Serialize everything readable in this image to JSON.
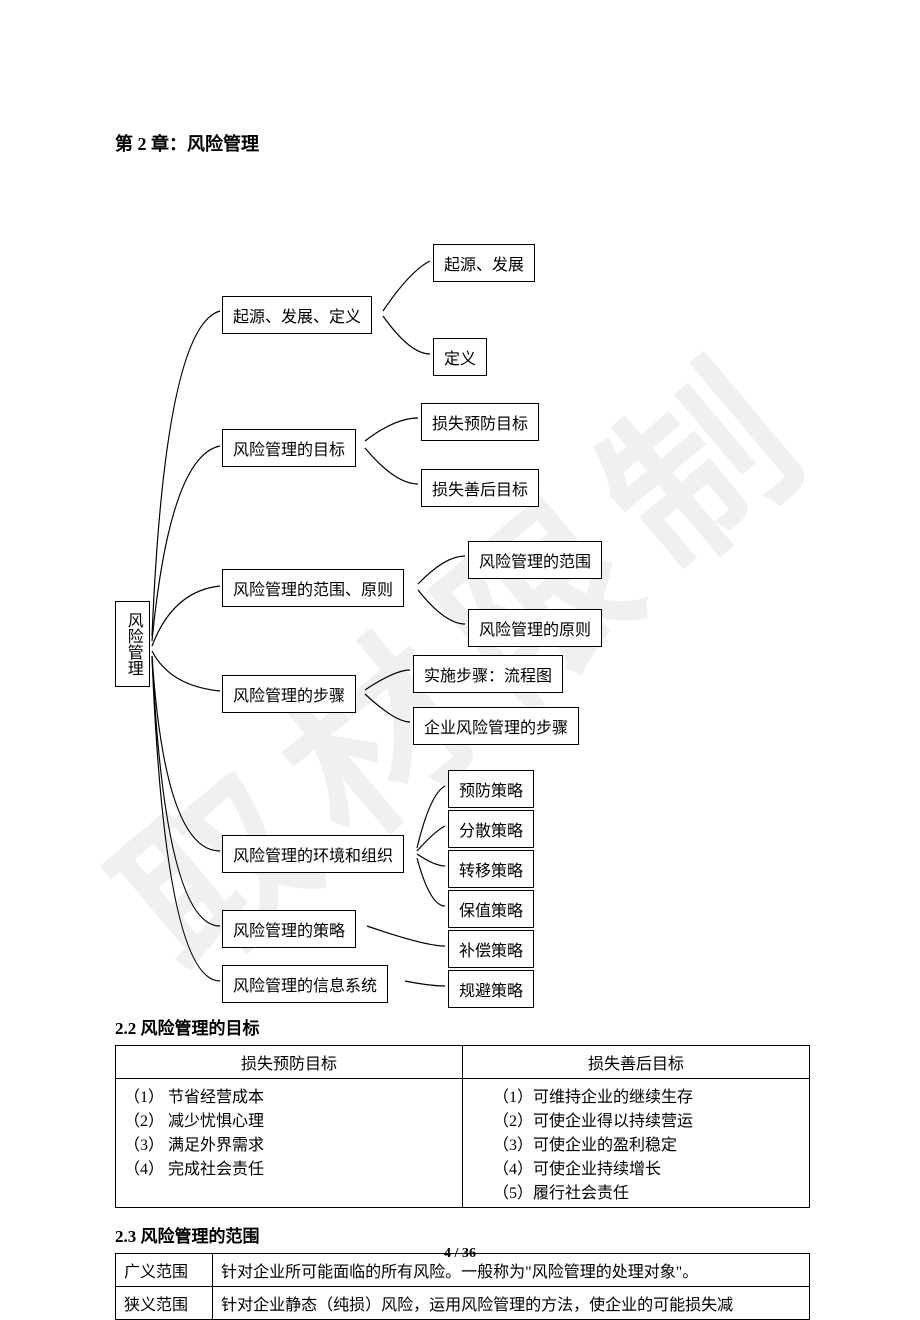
{
  "chapter_title": "第 2 章：风险管理",
  "diagram": {
    "root": "风险管理",
    "b1": {
      "label": "起源、发展、定义",
      "c1": "起源、发展",
      "c2": "定义"
    },
    "b2": {
      "label": "风险管理的目标",
      "c1": "损失预防目标",
      "c2": "损失善后目标"
    },
    "b3": {
      "label": "风险管理的范围、原则",
      "c1": "风险管理的范围",
      "c2": "风险管理的原则"
    },
    "b4": {
      "label": "风险管理的步骤",
      "c1": "实施步骤：流程图",
      "c2": "企业风险管理的步骤"
    },
    "b5": {
      "label": "风险管理的环境和组织"
    },
    "b6": {
      "label": "风险管理的策略",
      "s1": "预防策略",
      "s2": "分散策略",
      "s3": "转移策略",
      "s4": "保值策略",
      "s5": "补偿策略",
      "s6": "规避策略"
    },
    "b7": {
      "label": "风险管理的信息系统"
    }
  },
  "section22": {
    "title": "2.2 风险管理的目标",
    "header": [
      "损失预防目标",
      "损失善后目标"
    ],
    "left": [
      "（1） 节省经营成本",
      "（2） 减少忧惧心理",
      "（3） 满足外界需求",
      "（4） 完成社会责任"
    ],
    "right": [
      "（1）可维持企业的继续生存",
      "（2）可使企业得以持续营运",
      "（3）可使企业的盈利稳定",
      "（4）可使企业持续增长",
      "（5）履行社会责任"
    ]
  },
  "section23": {
    "title": "2.3 风险管理的范围",
    "rows": [
      {
        "k": "广义范围",
        "v": "针对企业所可能面临的所有风险。一般称为\"风险管理的处理对象\"。"
      },
      {
        "k": "狭义范围",
        "v": "针对企业静态（纯损）风险，运用风险管理的方法，使企业的可能损失减"
      }
    ]
  },
  "footer": {
    "page": "4",
    "total": "36"
  }
}
